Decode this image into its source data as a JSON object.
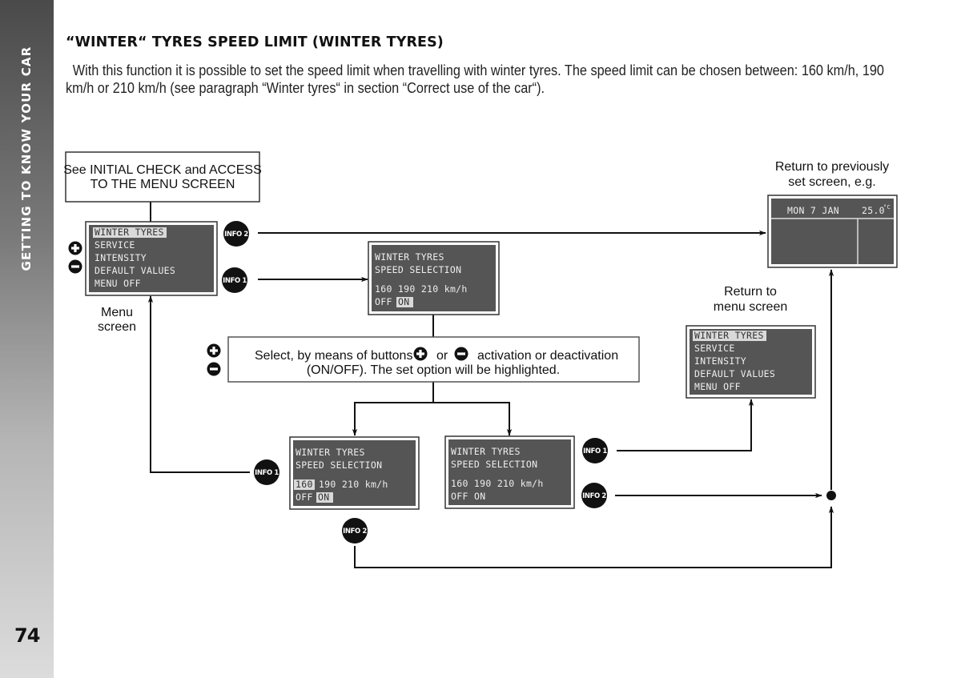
{
  "sidebar": {
    "section_title": "GETTING TO KNOW YOUR CAR",
    "page_number": "74"
  },
  "heading": "“WINTER“ TYRES SPEED LIMIT (WINTER TYRES)",
  "intro": "With this function it is possible to set the speed limit when travelling with winter tyres. The speed limit can be chosen between: 160 km/h, 190 km/h or 210 km/h (see paragraph “Winter tyres“ in section “Correct use of the car“).",
  "diagram": {
    "start_box": {
      "line1": "See INITIAL CHECK and ACCESS",
      "line2": "TO THE MENU SCREEN"
    },
    "menu_screen": {
      "items": [
        "WINTER TYRES",
        "SERVICE",
        "INTENSITY",
        "DEFAULT VALUES",
        "MENU OFF"
      ],
      "highlighted_index": 0,
      "caption_line1": "Menu",
      "caption_line2": "screen"
    },
    "speed_screen_top": {
      "line1": "WINTER TYRES",
      "line2": "SPEED SELECTION",
      "speeds": [
        "160",
        "190",
        "210"
      ],
      "unit": "km/h",
      "off_label": "OFF",
      "on_label": "ON",
      "highlighted": [
        "ON"
      ]
    },
    "instruction_box": {
      "line1_a": "Select, by means of buttons",
      "line1_or": "or",
      "line1_b": "activation or deactivation",
      "line2": "(ON/OFF). The set option will be highlighted."
    },
    "speed_screen_left": {
      "line1": "WINTER TYRES",
      "line2": "SPEED SELECTION",
      "speeds": [
        "160",
        "190",
        "210"
      ],
      "unit": "km/h",
      "off_label": "OFF",
      "on_label": "ON",
      "highlighted": [
        "160",
        "ON"
      ]
    },
    "speed_screen_right": {
      "line1": "WINTER TYRES",
      "line2": "SPEED SELECTION",
      "speeds": [
        "160",
        "190",
        "210"
      ],
      "unit": "km/h",
      "off_label": "OFF",
      "on_label": "ON",
      "highlighted": []
    },
    "return_menu": {
      "caption_line1": "Return to",
      "caption_line2": "menu screen",
      "items": [
        "WINTER TYRES",
        "SERVICE",
        "INTENSITY",
        "DEFAULT VALUES",
        "MENU OFF"
      ],
      "highlighted_index": 0
    },
    "return_previous": {
      "caption_line1": "Return to previously",
      "caption_line2": "set screen, e.g.",
      "date": "MON 7 JAN",
      "temperature": "25.0",
      "temp_unit": "°C"
    },
    "buttons": {
      "info1": "INFO 1",
      "info2": "INFO 2",
      "plus_icon": "plus-circle",
      "minus_icon": "minus-circle"
    }
  }
}
